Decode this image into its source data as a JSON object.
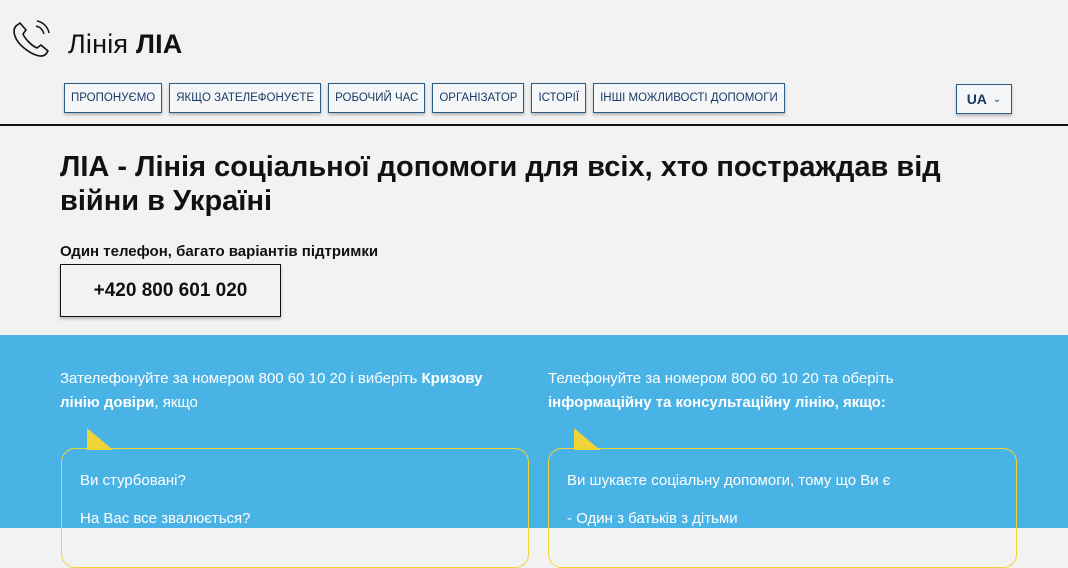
{
  "header": {
    "logo_prefix": "Лінія",
    "logo_bold": "ЛІА",
    "logo_icon": "phone-icon"
  },
  "nav": [
    {
      "label": "ПРОПОНУЄМО"
    },
    {
      "label": "ЯКЩО ЗАТЕЛЕФОНУЄТЕ"
    },
    {
      "label": "РОБОЧИЙ ЧАС"
    },
    {
      "label": "ОРГАНІЗАТОР"
    },
    {
      "label": "ІСТОРІЇ"
    },
    {
      "label": "ІНШІ МОЖЛИВОСТІ ДОПОМОГИ"
    }
  ],
  "lang": {
    "value": "UA",
    "icon": "chevron-down-icon"
  },
  "hero": {
    "title": "ЛІА - Лінія соціальної допомоги для всіх, хто постраждав від війни в Україні",
    "subtitle": "Один телефон, багато варіантів підтримки",
    "phone": "+420 800 601 020"
  },
  "left": {
    "text_a": "Зателефонуйте за номером 800 60 10 20 і виберіть ",
    "text_bold": "Кризову лінію довіри",
    "text_b": ", якщо",
    "q1": "Ви стурбовані?",
    "q2": "На Вас все звалюється?"
  },
  "right": {
    "text_a": "Телефонуйте за номером 800 60 10 20 та оберіть ",
    "text_bold": "інформаційну та консультаційну лінію, якщо:",
    "q1": "Ви шукаєте соціальну допомоги, тому що Ви є",
    "q2": "- Один з батьків з дітьми"
  },
  "colors": {
    "accent_blue": "#4ab3e6",
    "accent_yellow": "#f0d437",
    "nav_border": "#2a5c8a"
  }
}
